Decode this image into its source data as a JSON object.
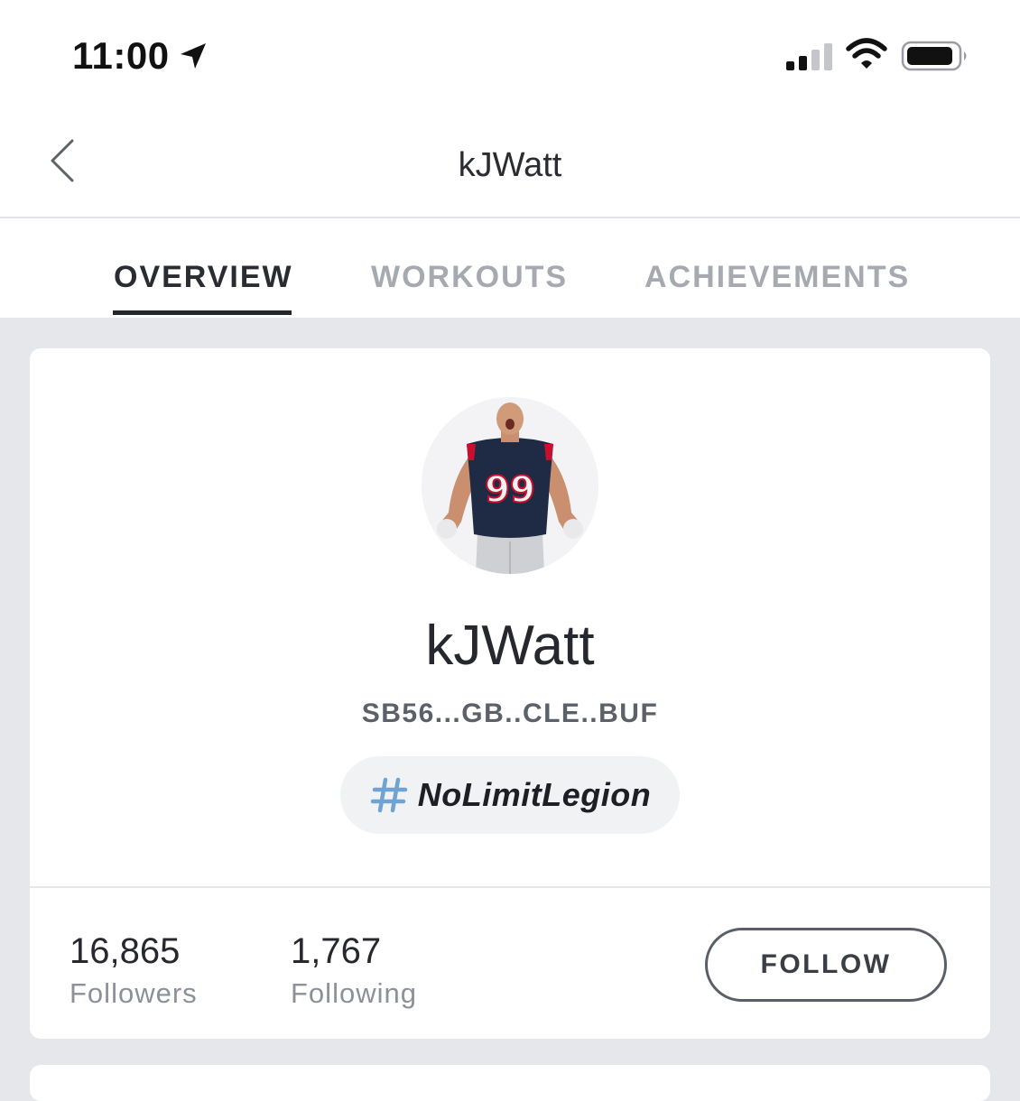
{
  "status_bar": {
    "time": "11:00"
  },
  "nav": {
    "title": "kJWatt"
  },
  "tabs": [
    {
      "label": "OVERVIEW",
      "active": true
    },
    {
      "label": "WORKOUTS",
      "active": false
    },
    {
      "label": "ACHIEVEMENTS",
      "active": false
    }
  ],
  "profile": {
    "display_name": "kJWatt",
    "bio": "SB56...GB..CLE..BUF",
    "hashtag": "NoLimitLegion",
    "jersey_number": "99",
    "followers": {
      "count": "16,865",
      "label": "Followers"
    },
    "following": {
      "count": "1,767",
      "label": "Following"
    },
    "follow_button": "FOLLOW"
  },
  "colors": {
    "accent_hashtag": "#6fa3d4",
    "jersey_navy": "#1f2a44",
    "jersey_red": "#c8102e"
  }
}
